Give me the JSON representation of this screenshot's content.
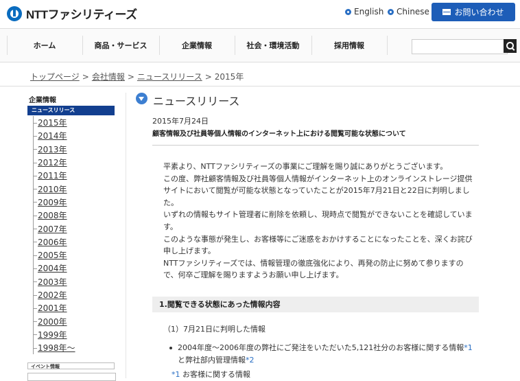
{
  "header": {
    "logo_text": "NTTファシリティーズ",
    "lang_en": "English",
    "lang_zh": "Chinese",
    "contact_label": "お問い合わせ"
  },
  "nav": {
    "items": [
      "ホーム",
      "商品・サービス",
      "企業情報",
      "社会・環境活動",
      "採用情報"
    ],
    "search_placeholder": ""
  },
  "breadcrumb": {
    "top": "トップページ",
    "company": "会社情報",
    "news": "ニュースリリース",
    "current": "2015年",
    "sep": ">"
  },
  "sidebar": {
    "title": "企業情報",
    "active": "ニュースリリース",
    "years": [
      "2015年",
      "2014年",
      "2013年",
      "2012年",
      "2011年",
      "2010年",
      "2009年",
      "2008年",
      "2007年",
      "2006年",
      "2005年",
      "2004年",
      "2003年",
      "2002年",
      "2001年",
      "2000年",
      "1999年",
      "1998年～"
    ],
    "box1": "イベント情報"
  },
  "main": {
    "heading": "ニュースリリース",
    "date": "2015年7月24日",
    "subject": "顧客情報及び社員等個人情報のインターネット上における閲覧可能な状態について",
    "paragraphs": [
      "平素より、NTTファシリティーズの事業にご理解を賜り誠にありがとうございます。",
      "この度、弊社顧客情報及び社員等個人情報がインターネット上のオンラインストレージ提供サイトにおいて閲覧が可能な状態となっていたことが2015年7月21日と22日に判明しました。",
      "いずれの情報もサイト管理者に削除を依頼し、現時点で閲覧ができないことを確認しています。",
      "このような事態が発生し、お客様等にご迷惑をおかけすることになったことを、深くお詫び申し上げます。",
      "NTTファシリティーズでは、情報管理の徹底強化により、再発の防止に努めて参りますので、何卒ご理解を賜りますようお願い申し上げます。"
    ],
    "section1": "1.閲覧できる状態にあった情報内容",
    "sub1": "（1）7月21日に判明した情報",
    "bullet_a": "2004年度～2006年度の弊社にご発注をいただいた5,121社分のお客様に関する情報",
    "note1": "*1",
    "bullet_mid": "と弊社部内管理情報",
    "note2": "*2",
    "footnote_mark": "*1",
    "footnote_text": "お客様に関する情報"
  },
  "colors": {
    "brand_blue": "#1d5db8",
    "sidebar_active": "#123f8f",
    "link_note": "#2a6fc4"
  }
}
